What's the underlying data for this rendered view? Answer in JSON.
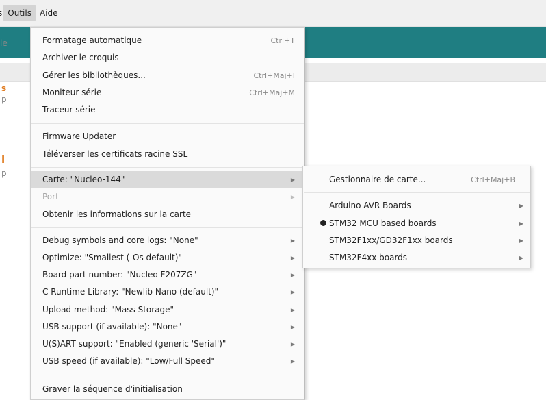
{
  "menubar": {
    "items": [
      {
        "label": "s",
        "active": false
      },
      {
        "label": "Outils",
        "active": true
      },
      {
        "label": "Aide",
        "active": false
      }
    ]
  },
  "background": {
    "frag_1": "le",
    "frag_2": "s",
    "frag_3": "p",
    "frag_4": "l",
    "frag_5": "p",
    "accent_color": "#1f7e82"
  },
  "menu": {
    "items": [
      {
        "label": "Formatage automatique",
        "shortcut": "Ctrl+T"
      },
      {
        "label": "Archiver le croquis",
        "shortcut": ""
      },
      {
        "label": "Gérer les bibliothèques...",
        "shortcut": "Ctrl+Maj+I"
      },
      {
        "label": "Moniteur série",
        "shortcut": "Ctrl+Maj+M"
      },
      {
        "label": "Traceur série",
        "shortcut": ""
      },
      {
        "label": "Firmware Updater",
        "shortcut": ""
      },
      {
        "label": "Téléverser les certificats racine SSL",
        "shortcut": ""
      },
      {
        "label": "Carte: \"Nucleo-144\"",
        "submenu": true,
        "highlighted": true
      },
      {
        "label": "Port",
        "submenu": true,
        "disabled": true
      },
      {
        "label": "Obtenir les informations sur la carte",
        "shortcut": ""
      },
      {
        "label": "Debug symbols and core logs: \"None\"",
        "submenu": true
      },
      {
        "label": "Optimize: \"Smallest (-Os default)\"",
        "submenu": true
      },
      {
        "label": "Board part number: \"Nucleo F207ZG\"",
        "submenu": true
      },
      {
        "label": "C Runtime Library: \"Newlib Nano (default)\"",
        "submenu": true
      },
      {
        "label": "Upload method: \"Mass Storage\"",
        "submenu": true
      },
      {
        "label": "USB support (if available): \"None\"",
        "submenu": true
      },
      {
        "label": "U(S)ART support: \"Enabled (generic 'Serial')\"",
        "submenu": true
      },
      {
        "label": "USB speed (if available): \"Low/Full Speed\"",
        "submenu": true
      },
      {
        "label": "Graver la séquence d'initialisation",
        "shortcut": ""
      }
    ],
    "arrow_glyph": "▶"
  },
  "submenu": {
    "items": [
      {
        "label": "Gestionnaire de carte...",
        "shortcut": "Ctrl+Maj+B"
      },
      {
        "label": "Arduino AVR Boards",
        "submenu": true
      },
      {
        "label": "STM32 MCU based boards",
        "submenu": true,
        "selected": true
      },
      {
        "label": "STM32F1xx/GD32F1xx boards",
        "submenu": true
      },
      {
        "label": "STM32F4xx boards",
        "submenu": true
      }
    ]
  }
}
